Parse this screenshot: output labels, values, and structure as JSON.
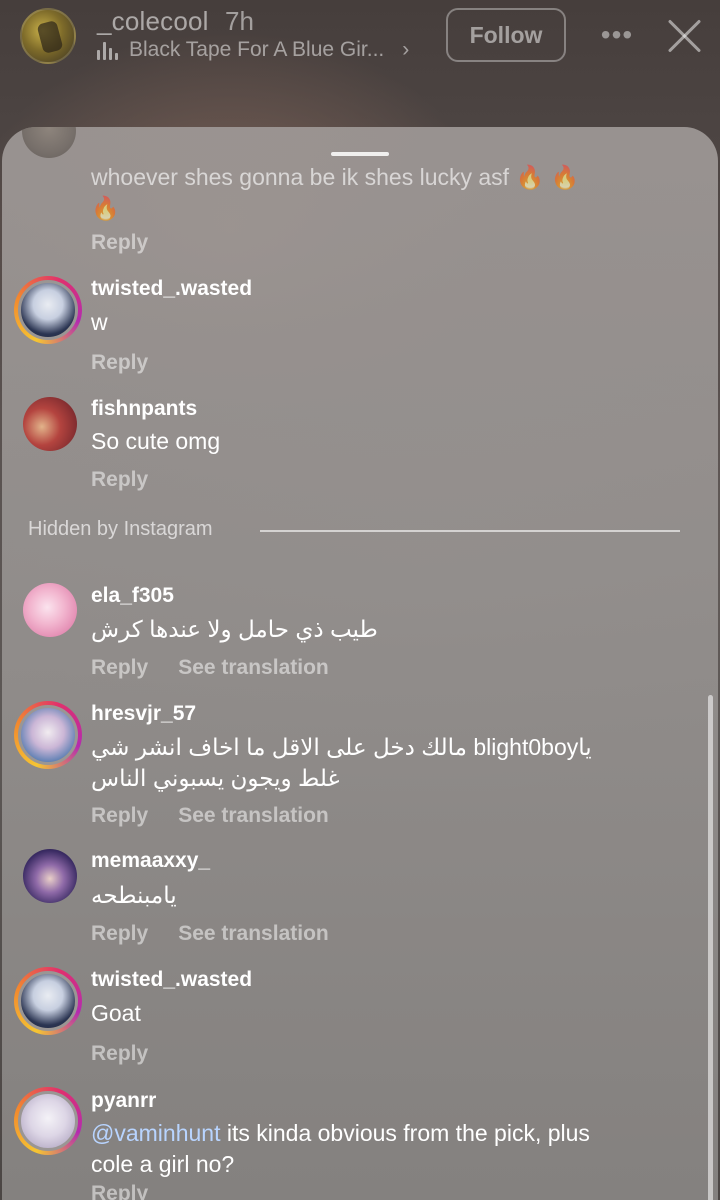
{
  "story": {
    "username": "_colecool",
    "time": "7h",
    "music": "Black Tape For A Blue Gir...",
    "follow_label": "Follow",
    "more_label": "•••"
  },
  "comments": [
    {
      "username": "",
      "text": "whoever shes gonna be ik shes lucky asf 🔥 🔥 🔥",
      "actions": [
        "Reply"
      ]
    },
    {
      "username": "twisted_.wasted",
      "text": "w",
      "actions": [
        "Reply"
      ]
    },
    {
      "username": "fishnpants",
      "text": "So cute omg",
      "actions": [
        "Reply"
      ]
    },
    {
      "username": "ela_f305",
      "text": "طيب ذي حامل ولا عندها كرش",
      "actions": [
        "Reply",
        "See translation"
      ]
    },
    {
      "username": "hresvjr_57",
      "text": "ياblight0boy مالك دخل على الاقل ما اخاف انشر شي غلط ويجون يسبوني الناس",
      "actions": [
        "Reply",
        "See translation"
      ]
    },
    {
      "username": "memaaxxy_",
      "text": "يامبنطحه",
      "actions": [
        "Reply",
        "See translation"
      ]
    },
    {
      "username": "twisted_.wasted",
      "text": "Goat",
      "actions": [
        "Reply"
      ]
    },
    {
      "username": "pyanrr",
      "mention": "@vaminhunt",
      "text": " its kinda obvious from the pick, plus cole a girl no?",
      "actions": [
        "Reply"
      ]
    }
  ],
  "hidden_label": "Hidden by Instagram"
}
